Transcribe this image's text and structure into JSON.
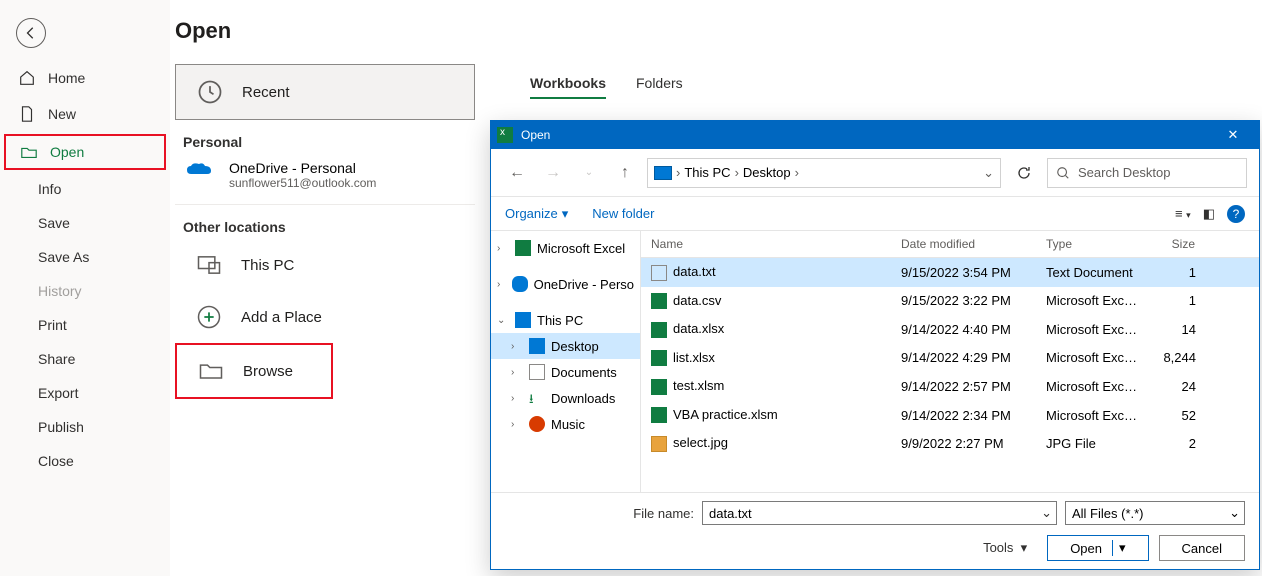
{
  "sidebar": {
    "home": "Home",
    "new": "New",
    "open": "Open",
    "info": "Info",
    "save": "Save",
    "saveas": "Save As",
    "history": "History",
    "print": "Print",
    "share": "Share",
    "export": "Export",
    "publish": "Publish",
    "close": "Close"
  },
  "page": {
    "title": "Open",
    "recent": "Recent",
    "personal": "Personal",
    "onedrive": "OneDrive - Personal",
    "onedrive_sub": "sunflower511@outlook.com",
    "other": "Other locations",
    "thispc": "This PC",
    "addplace": "Add a Place",
    "browse": "Browse"
  },
  "tabs": {
    "workbooks": "Workbooks",
    "folders": "Folders"
  },
  "dialog": {
    "title": "Open",
    "breadcrumb": {
      "thispc": "This PC",
      "desktop": "Desktop"
    },
    "search_placeholder": "Search Desktop",
    "organize": "Organize",
    "newfolder": "New folder",
    "columns": {
      "name": "Name",
      "date": "Date modified",
      "type": "Type",
      "size": "Size"
    },
    "tree": {
      "excel": "Microsoft Excel",
      "onedrive": "OneDrive - Perso",
      "thispc": "This PC",
      "desktop": "Desktop",
      "documents": "Documents",
      "downloads": "Downloads",
      "music": "Music"
    },
    "files": [
      {
        "name": "data.txt",
        "date": "9/15/2022 3:54 PM",
        "type": "Text Document",
        "size": "1",
        "icon": "txt"
      },
      {
        "name": "data.csv",
        "date": "9/15/2022 3:22 PM",
        "type": "Microsoft Excel C...",
        "size": "1",
        "icon": "xls"
      },
      {
        "name": "data.xlsx",
        "date": "9/14/2022 4:40 PM",
        "type": "Microsoft Excel W...",
        "size": "14",
        "icon": "xls"
      },
      {
        "name": "list.xlsx",
        "date": "9/14/2022 4:29 PM",
        "type": "Microsoft Excel W...",
        "size": "8,244",
        "icon": "xls"
      },
      {
        "name": "test.xlsm",
        "date": "9/14/2022 2:57 PM",
        "type": "Microsoft Excel M...",
        "size": "24",
        "icon": "xls"
      },
      {
        "name": "VBA practice.xlsm",
        "date": "9/14/2022 2:34 PM",
        "type": "Microsoft Excel M...",
        "size": "52",
        "icon": "xls"
      },
      {
        "name": "select.jpg",
        "date": "9/9/2022 2:27 PM",
        "type": "JPG File",
        "size": "2",
        "icon": "img"
      }
    ],
    "filename_label": "File name:",
    "filename_value": "data.txt",
    "filter": "All Files (*.*)",
    "tools": "Tools",
    "open_btn": "Open",
    "cancel_btn": "Cancel"
  }
}
